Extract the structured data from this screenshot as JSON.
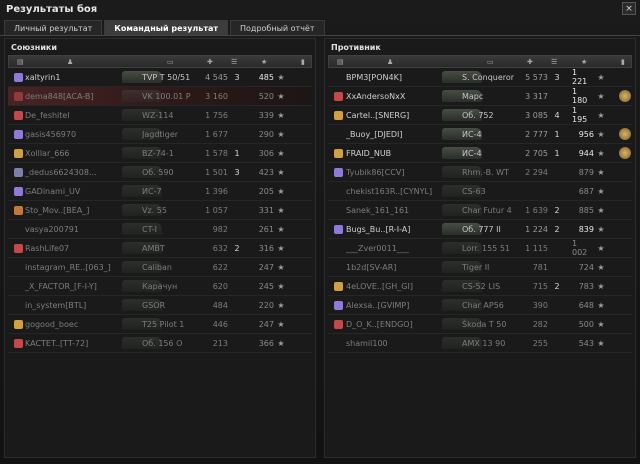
{
  "window": {
    "title": "Результаты боя",
    "close_label": "×"
  },
  "tabs": [
    {
      "label": "Личный результат",
      "active": false
    },
    {
      "label": "Командный результат",
      "active": true
    },
    {
      "label": "Подробный отчёт",
      "active": false
    }
  ],
  "allies": {
    "title": "Союзники",
    "rows": [
      {
        "name": "xaltyrin1",
        "tank": "TVP T 50/51",
        "damage": "4 545",
        "kills": "3",
        "xp": "485",
        "alive": true,
        "self": false,
        "rank": "#8f7bd6",
        "medal": false
      },
      {
        "name": "dema848[ACA-B]",
        "tank": "VK 100.01 P",
        "damage": "3 160",
        "kills": "",
        "xp": "520",
        "alive": false,
        "self": true,
        "rank": "#8e3b3b",
        "medal": false
      },
      {
        "name": "De_feshitel",
        "tank": "WZ-114",
        "damage": "1 756",
        "kills": "",
        "xp": "339",
        "alive": false,
        "self": false,
        "rank": "#c24a4a",
        "medal": false
      },
      {
        "name": "gasis456970",
        "tank": "Jagdtiger",
        "damage": "1 677",
        "kills": "",
        "xp": "290",
        "alive": false,
        "self": false,
        "rank": "#8f7bd6",
        "medal": false
      },
      {
        "name": "Xolllar_666",
        "tank": "BZ-74-1",
        "damage": "1 578",
        "kills": "1",
        "xp": "306",
        "alive": false,
        "self": false,
        "rank": "#d0a045",
        "medal": false
      },
      {
        "name": "_dedus6624308...",
        "tank": "Об. 590",
        "damage": "1 501",
        "kills": "3",
        "xp": "423",
        "alive": false,
        "self": false,
        "rank": "#7e7eaa",
        "medal": false
      },
      {
        "name": "GADinami_UV",
        "tank": "ИС-7",
        "damage": "1 396",
        "kills": "",
        "xp": "205",
        "alive": false,
        "self": false,
        "rank": "#8f7bd6",
        "medal": false
      },
      {
        "name": "Sto_Mov..[BEA_]",
        "tank": "Vz. 55",
        "damage": "1 057",
        "kills": "",
        "xp": "331",
        "alive": false,
        "self": false,
        "rank": "#c07a3a",
        "medal": false
      },
      {
        "name": "vasya200791",
        "tank": "CT-I",
        "damage": "982",
        "kills": "",
        "xp": "261",
        "alive": false,
        "self": false,
        "rank": "",
        "medal": false
      },
      {
        "name": "RashLife07",
        "tank": "AMBT",
        "damage": "632",
        "kills": "2",
        "xp": "316",
        "alive": false,
        "self": false,
        "rank": "#c24a4a",
        "medal": false
      },
      {
        "name": "instagram_RE..[063_]",
        "tank": "Caliban",
        "damage": "622",
        "kills": "",
        "xp": "247",
        "alive": false,
        "self": false,
        "rank": "",
        "medal": false
      },
      {
        "name": "_X_FACTOR_[F-I-Y]",
        "tank": "Карачун",
        "damage": "620",
        "kills": "",
        "xp": "245",
        "alive": false,
        "self": false,
        "rank": "",
        "medal": false
      },
      {
        "name": "in_system[BTL]",
        "tank": "GSOR",
        "damage": "484",
        "kills": "",
        "xp": "220",
        "alive": false,
        "self": false,
        "rank": "",
        "medal": false
      },
      {
        "name": "gogood_boec",
        "tank": "T25 Pilot 1",
        "damage": "446",
        "kills": "",
        "xp": "247",
        "alive": false,
        "self": false,
        "rank": "#d0a045",
        "medal": false
      },
      {
        "name": "KACTET..[TT-72]",
        "tank": "Об. 156 О",
        "damage": "213",
        "kills": "",
        "xp": "366",
        "alive": false,
        "self": false,
        "rank": "#c24a4a",
        "medal": false
      }
    ]
  },
  "enemies": {
    "title": "Противник",
    "rows": [
      {
        "name": "BPM3[PON4K]",
        "tank": "S. Conqueror",
        "damage": "5 573",
        "kills": "3",
        "xp": "1 221",
        "alive": true,
        "rank": "",
        "medal": false
      },
      {
        "name": "XxAndersoNxX",
        "tank": "Марс",
        "damage": "3 317",
        "kills": "",
        "xp": "1 180",
        "alive": true,
        "rank": "#c24a4a",
        "medal": true
      },
      {
        "name": "Cartel..[SNERG]",
        "tank": "Об. 752",
        "damage": "3 085",
        "kills": "4",
        "xp": "1 195",
        "alive": true,
        "rank": "#d0a045",
        "medal": false
      },
      {
        "name": "_Buoy_[DJEDI]",
        "tank": "ИС-4",
        "damage": "2 777",
        "kills": "1",
        "xp": "956",
        "alive": true,
        "rank": "",
        "medal": true
      },
      {
        "name": "FRAID_NUB",
        "tank": "ИС-4",
        "damage": "2 705",
        "kills": "1",
        "xp": "944",
        "alive": true,
        "rank": "#d0a045",
        "medal": true
      },
      {
        "name": "Tyubik86[CCV]",
        "tank": "Rhm.-B. WT",
        "damage": "2 294",
        "kills": "",
        "xp": "879",
        "alive": false,
        "rank": "#8f7bd6",
        "medal": false
      },
      {
        "name": "chekist163R..[CYNYL]",
        "tank": "CS-63",
        "damage": "",
        "kills": "",
        "xp": "687",
        "alive": false,
        "rank": "",
        "medal": false
      },
      {
        "name": "Sanek_161_161",
        "tank": "Char Futur 4",
        "damage": "1 639",
        "kills": "2",
        "xp": "885",
        "alive": false,
        "rank": "",
        "medal": false
      },
      {
        "name": "Bugs_Bu..[R-I-A]",
        "tank": "Об. 777 II",
        "damage": "1 224",
        "kills": "2",
        "xp": "839",
        "alive": true,
        "rank": "#8f7bd6",
        "medal": false
      },
      {
        "name": "___Zver0011___",
        "tank": "Lorr. 155 51",
        "damage": "1 115",
        "kills": "",
        "xp": "1 002",
        "alive": false,
        "rank": "",
        "medal": false
      },
      {
        "name": "1b2d[SV-AR]",
        "tank": "Tiger II",
        "damage": "781",
        "kills": "",
        "xp": "724",
        "alive": false,
        "rank": "",
        "medal": false
      },
      {
        "name": "4eLOVE..[GH_GI]",
        "tank": "CS-52 LIS",
        "damage": "715",
        "kills": "2",
        "xp": "783",
        "alive": false,
        "rank": "#d0a045",
        "medal": false
      },
      {
        "name": "Alexsa..[GVIMP]",
        "tank": "Char AP56",
        "damage": "390",
        "kills": "",
        "xp": "648",
        "alive": false,
        "rank": "#8f7bd6",
        "medal": false
      },
      {
        "name": "D_O_K..[ENDGO]",
        "tank": "Škoda T 50",
        "damage": "282",
        "kills": "",
        "xp": "500",
        "alive": false,
        "rank": "#c24a4a",
        "medal": false
      },
      {
        "name": "shamil100",
        "tank": "AMX 13 90",
        "damage": "255",
        "kills": "",
        "xp": "543",
        "alive": false,
        "rank": "",
        "medal": false
      }
    ]
  },
  "colors": {
    "self_row": "#4a2323",
    "accent": "#8f7bd6",
    "gold": "#d0a045"
  }
}
